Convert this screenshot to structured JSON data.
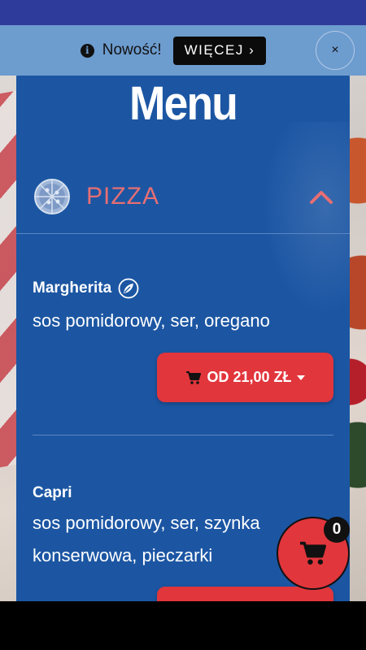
{
  "notice": {
    "text": "Nowość!",
    "more_label": "WIĘCEJ ›",
    "close_label": "×"
  },
  "menu": {
    "title": "Menu"
  },
  "category": {
    "label": "PIZZA"
  },
  "items": [
    {
      "name": "Margherita",
      "vegetarian": true,
      "description": "sos pomidorowy, ser, oregano",
      "price_label": "OD 21,00 ZŁ"
    },
    {
      "name": "Capri",
      "vegetarian": false,
      "description": "sos pomidorowy, ser, szynka konserwowa, pieczarki",
      "price_label": ""
    }
  ],
  "cart": {
    "count": "0"
  },
  "colors": {
    "status_bar": "#2f3b9b",
    "notice_bg": "#6d9ccf",
    "panel_bg": "#1c56a3",
    "accent_red": "#e1363c",
    "category_text": "#e66e73"
  }
}
